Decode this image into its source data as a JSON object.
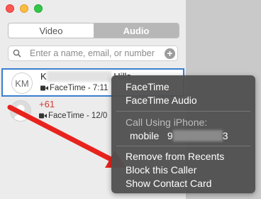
{
  "tabs": [
    {
      "label": "Video"
    },
    {
      "label": "Audio"
    }
  ],
  "search": {
    "placeholder": "Enter a name, email, or number"
  },
  "contacts": [
    {
      "initials": "KM",
      "name_start": "K",
      "name_end": "Hills",
      "subtitle": "FaceTime - 7:11"
    },
    {
      "name_start": "+61",
      "subtitle": "FaceTime - 12/0"
    }
  ],
  "context_menu": {
    "items": [
      "FaceTime",
      "FaceTime Audio"
    ],
    "call_header": "Call Using iPhone:",
    "mobile_label": "mobile",
    "mobile_start": "9",
    "mobile_end": "3",
    "actions": [
      "Remove from Recents",
      "Block this Caller",
      "Show Contact Card"
    ]
  },
  "colors": {
    "selection": "#3b7fd1",
    "arrow": "#e8231d",
    "menu_bg": "#505050"
  }
}
